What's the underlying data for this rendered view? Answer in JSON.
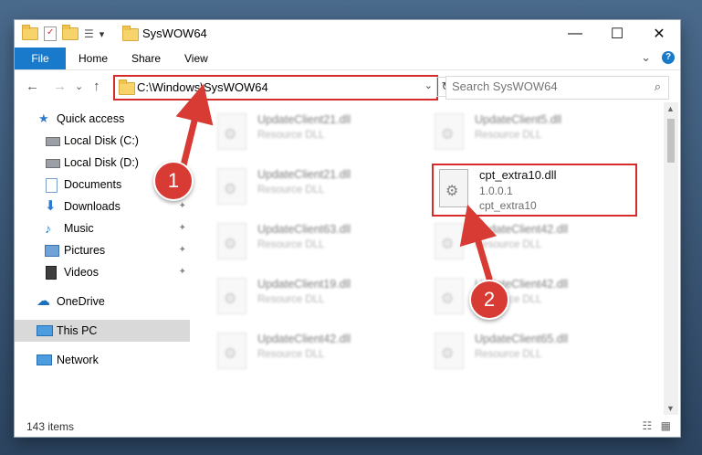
{
  "window": {
    "title": "SysWOW64",
    "qat_dropdown_icon": "▾",
    "controls": {
      "minimize": "—",
      "maximize": "☐",
      "close": "✕"
    }
  },
  "ribbon": {
    "tabs": [
      "File",
      "Home",
      "Share",
      "View"
    ],
    "expand_icon": "⌄",
    "help_icon": "?"
  },
  "address": {
    "back_icon": "←",
    "forward_icon": "→",
    "recent_icon": "⌄",
    "up_icon": "↑",
    "path": "C:\\Windows\\SysWOW64",
    "dropdown_icon": "⌄",
    "refresh_icon": "↻"
  },
  "search": {
    "placeholder": "Search SysWOW64",
    "icon": "⌕"
  },
  "sidebar": {
    "items": [
      {
        "label": "Quick access",
        "icon": "star-icon",
        "pinned": false
      },
      {
        "label": "Local Disk (C:)",
        "icon": "drive-icon",
        "pinned": false
      },
      {
        "label": "Local Disk (D:)",
        "icon": "drive-icon",
        "pinned": false
      },
      {
        "label": "Documents",
        "icon": "documents-icon",
        "pinned": true
      },
      {
        "label": "Downloads",
        "icon": "download-icon",
        "pinned": true
      },
      {
        "label": "Music",
        "icon": "music-icon",
        "pinned": true
      },
      {
        "label": "Pictures",
        "icon": "pictures-icon",
        "pinned": true
      },
      {
        "label": "Videos",
        "icon": "videos-icon",
        "pinned": true
      },
      {
        "label": "OneDrive",
        "icon": "cloud-icon",
        "pinned": false
      },
      {
        "label": "This PC",
        "icon": "computer-icon",
        "pinned": false
      },
      {
        "label": "Network",
        "icon": "network-icon",
        "pinned": false
      }
    ],
    "pin_icon": "📌",
    "selected": "This PC"
  },
  "files": {
    "left": [
      {
        "name": "UpdateClient21.dll",
        "desc": "Resource DLL"
      },
      {
        "name": "UpdateClient21.dll",
        "desc": "Resource DLL"
      },
      {
        "name": "UpdateClient63.dll",
        "desc": "Resource DLL"
      },
      {
        "name": "UpdateClient19.dll",
        "desc": "Resource DLL"
      },
      {
        "name": "UpdateClient42.dll",
        "desc": "Resource DLL"
      }
    ],
    "right": [
      {
        "name": "UpdateClient5.dll",
        "desc": "Resource DLL"
      },
      {
        "name": "UpdateClient42.dll",
        "desc": "Resource DLL"
      },
      {
        "name": "UpdateClient42.dll",
        "desc": "Resource DLL"
      },
      {
        "name": "UpdateClient65.dll",
        "desc": "Resource DLL"
      }
    ],
    "highlighted": {
      "name": "cpt_extra10.dll",
      "version": "1.0.0.1",
      "description": "cpt_extra10"
    }
  },
  "annotations": {
    "badge1": "1",
    "badge2": "2",
    "color": "#d73b33"
  },
  "status": {
    "item_count": "143 items",
    "details_view_icon": "☷",
    "large_icons_icon": "▦"
  },
  "scrollbar": {
    "up_icon": "▲",
    "down_icon": "▼"
  }
}
